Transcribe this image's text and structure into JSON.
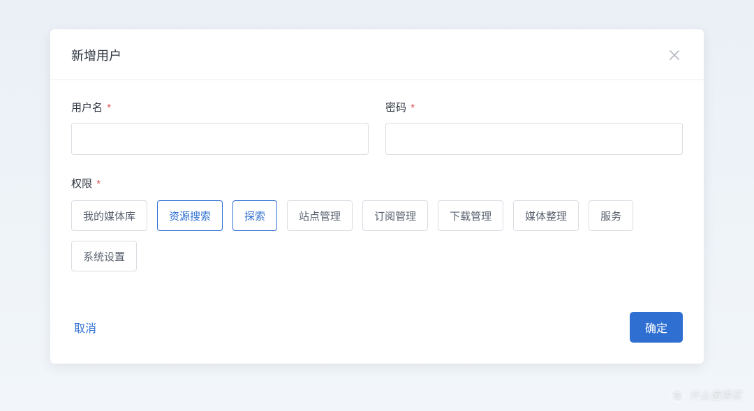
{
  "modal": {
    "title": "新增用户",
    "fields": {
      "username": {
        "label": "用户名",
        "value": "",
        "required": "*"
      },
      "password": {
        "label": "密码",
        "value": "",
        "required": "*"
      }
    },
    "permissions": {
      "label": "权限",
      "required": "*",
      "items": [
        {
          "label": "我的媒体库",
          "selected": false
        },
        {
          "label": "资源搜索",
          "selected": true
        },
        {
          "label": "探索",
          "selected": true
        },
        {
          "label": "站点管理",
          "selected": false
        },
        {
          "label": "订阅管理",
          "selected": false
        },
        {
          "label": "下载管理",
          "selected": false
        },
        {
          "label": "媒体整理",
          "selected": false
        },
        {
          "label": "服务",
          "selected": false
        },
        {
          "label": "系统设置",
          "selected": false
        }
      ]
    },
    "footer": {
      "cancel": "取消",
      "confirm": "确定"
    }
  },
  "watermark": {
    "badge": "值",
    "text": "什么值得买"
  }
}
